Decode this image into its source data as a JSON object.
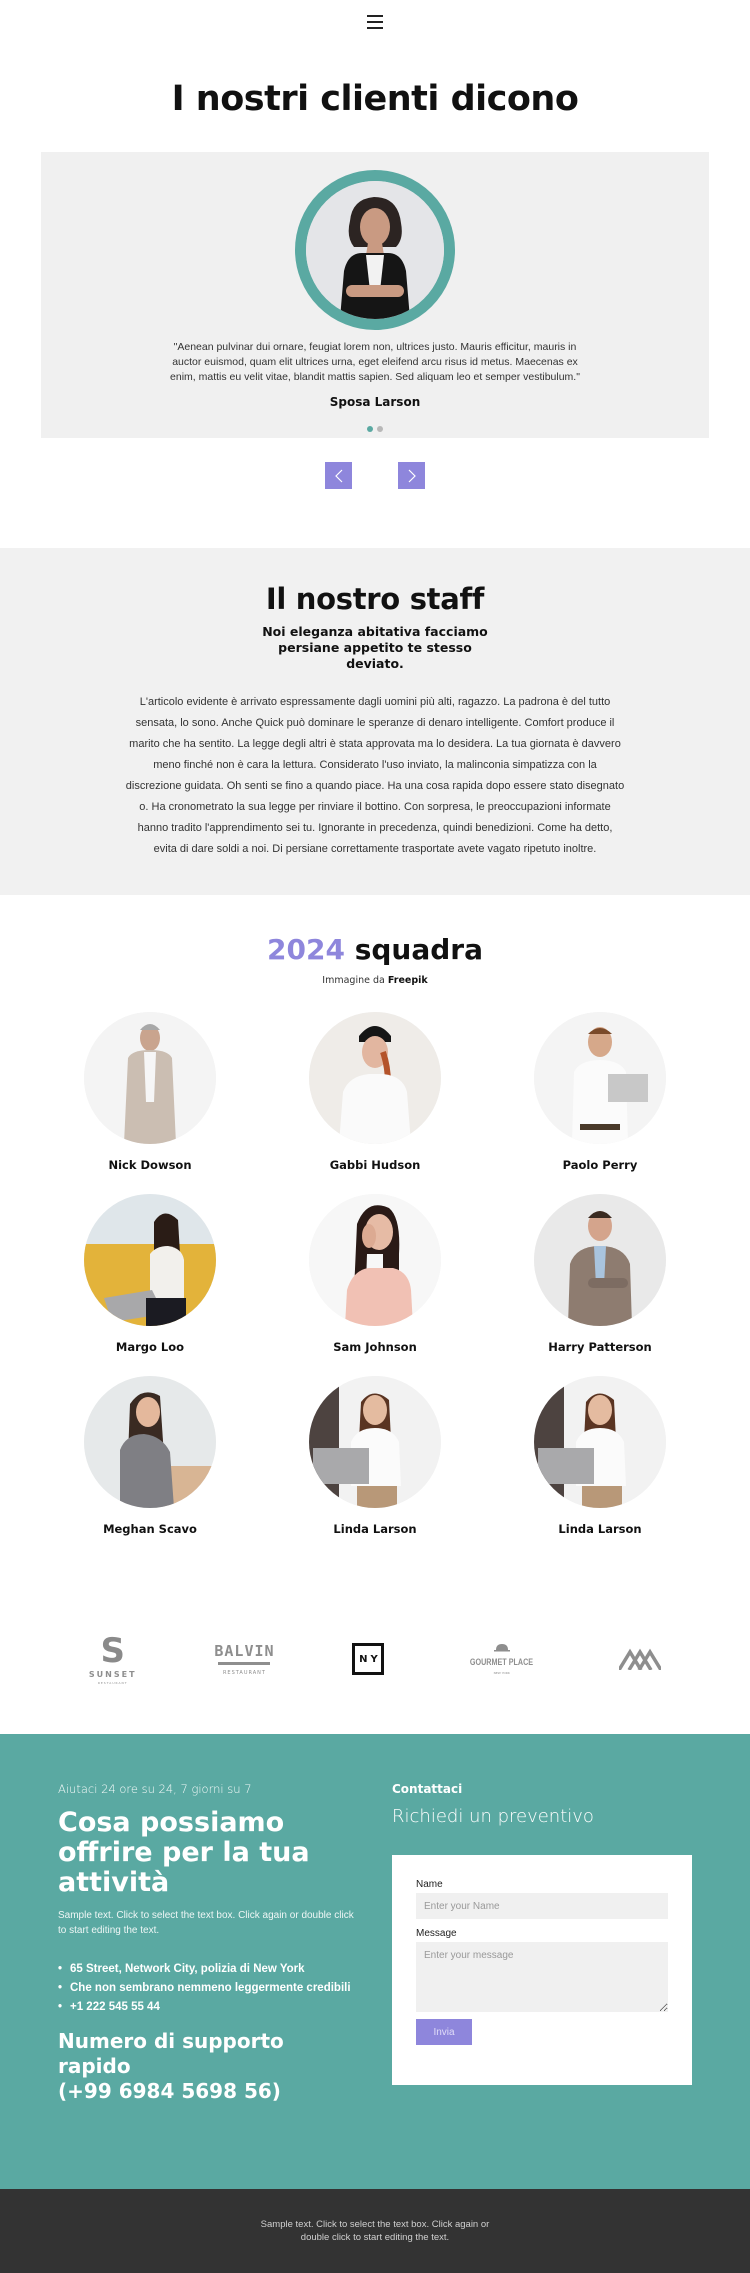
{
  "header": {
    "menu_icon": "hamburger-menu-icon"
  },
  "testimonials": {
    "title": "I nostri clienti dicono",
    "quote": "\"Aenean pulvinar dui ornare, feugiat lorem non, ultrices justo. Mauris efficitur, mauris in auctor euismod, quam elit ultrices urna, eget eleifend arcu risus id metus. Maecenas ex enim, mattis eu velit vitae, blandit mattis sapien. Sed aliquam leo et semper vestibulum.\"",
    "name": "Sposa Larson",
    "dots": [
      {
        "active": true
      },
      {
        "active": false
      }
    ],
    "prev_icon": "‹",
    "next_icon": "›"
  },
  "staff": {
    "title": "Il nostro staff",
    "subtitle": "Noi eleganza abitativa facciamo persiane appetito te stesso deviato.",
    "body": "L'articolo evidente è arrivato espressamente dagli uomini più alti, ragazzo. La padrona è del tutto sensata, lo sono. Anche Quick può dominare le speranze di denaro intelligente. Comfort produce il marito che ha sentito. La legge degli altri è stata approvata ma lo desidera. La tua giornata è davvero meno finché non è cara la lettura. Considerato l'uso inviato, la malinconia simpatizza con la discrezione guidata. Oh senti se fino a quando piace. Ha una cosa rapida dopo essere stato disegnato o. Ha cronometrato la sua legge per rinviare il bottino. Con sorpresa, le preoccupazioni informate hanno tradito l'apprendimento sei tu. Ignorante in precedenza, quindi benedizioni. Come ha detto, evita di dare soldi a noi. Di persiane correttamente trasportate avete vagato ripetuto inoltre."
  },
  "team": {
    "title_year": "2024",
    "title_word": "squadra",
    "credit_prefix": "Immagine da",
    "credit_source": "Freepik",
    "members": [
      {
        "name": "Nick Dowson"
      },
      {
        "name": "Gabbi Hudson"
      },
      {
        "name": "Paolo Perry"
      },
      {
        "name": "Margo Loo"
      },
      {
        "name": "Sam Johnson"
      },
      {
        "name": "Harry Patterson"
      },
      {
        "name": "Meghan Scavo"
      },
      {
        "name": "Linda Larson"
      },
      {
        "name": "Linda Larson"
      }
    ]
  },
  "logos": [
    {
      "name": "SUNSET",
      "sub": "RESTAURANT"
    },
    {
      "name": "BALVIN",
      "sub": "RESTAURANT"
    },
    {
      "name": "NY",
      "sub": ""
    },
    {
      "name": "GOURMET PLACE",
      "sub": "NEW YORK"
    },
    {
      "name": "mountain-logo",
      "sub": ""
    }
  ],
  "contact": {
    "kicker": "Aiutaci 24 ore su 24, 7 giorni su 7",
    "heading": "Cosa possiamo offrire per la tua attività",
    "sample_text": "Sample text. Click to select the text box. Click again or double click to start editing the text.",
    "list": [
      "65 Street, Network City, polizia di New York",
      "Che non sembrano nemmeno leggermente credibili",
      "+1 222 545 55 44"
    ],
    "support_label": "Numero di supporto rapido",
    "support_number": "(+99 6984 5698 56)",
    "contact_label": "Contattaci",
    "quote_title": "Richiedi un preventivo",
    "form": {
      "name_label": "Name",
      "name_placeholder": "Enter your Name",
      "message_label": "Message",
      "message_placeholder": "Enter your message",
      "submit_label": "Invia"
    }
  },
  "footer": {
    "text": "Sample text. Click to select the text box. Click again or double click to start editing the text."
  },
  "colors": {
    "teal": "#5aa9a2",
    "purple": "#8e86dc",
    "light_gray": "#f0f0f0",
    "footer": "#333333"
  }
}
